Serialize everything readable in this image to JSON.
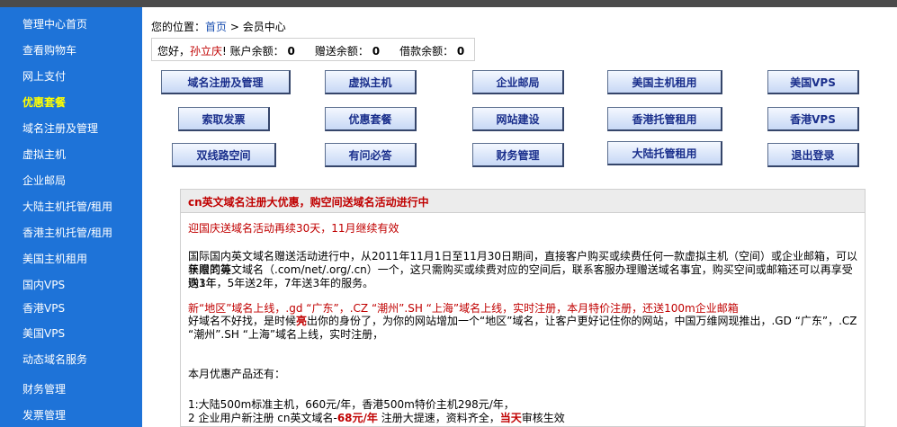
{
  "sidebar": {
    "items": [
      {
        "label": "管理中心首页"
      },
      {
        "label": "查看购物车"
      },
      {
        "label": "网上支付"
      },
      {
        "label": "优惠套餐"
      },
      {
        "label": "域名注册及管理"
      },
      {
        "label": "虚拟主机"
      },
      {
        "label": "企业邮局"
      },
      {
        "label": "大陆主机托管/租用"
      },
      {
        "label": "香港主机托管/租用"
      },
      {
        "label": "美国主机租用"
      },
      {
        "label": "国内VPS"
      },
      {
        "label": "香港VPS"
      },
      {
        "label": "美国VPS"
      },
      {
        "label": "动态域名服务"
      },
      {
        "label": "财务管理"
      },
      {
        "label": "发票管理"
      }
    ]
  },
  "breadcrumb": {
    "prefix": "您的位置：",
    "home": "首页",
    "sep": " > ",
    "current": "会员中心"
  },
  "balance": {
    "greeting": "您好，",
    "user": "孙立庆",
    "bang": "!",
    "account_label": " 账户余额：",
    "account_value": "0",
    "gift_label": "赠送余额：",
    "gift_value": "0",
    "loan_label": "借款余额：",
    "loan_value": "0"
  },
  "buttons": [
    "域名注册及管理",
    "虚拟主机",
    "企业邮局",
    "美国主机租用",
    "美国VPS",
    "索取发票",
    "优惠套餐",
    "网站建设",
    "香港托管租用",
    "香港VPS",
    "双线路空间",
    "有问必答",
    "财务管理",
    "大陆托管租用",
    "退出登录"
  ],
  "news": {
    "title": "cn英文域名注册大优惠，购空间送域名活动进行中",
    "p1": "迎国庆送域名活动再续30天，11月继续有效",
    "p2a": "国际国内英文域名赠送活动进行中，从2011年11月1日至11月30日期间，直接客户购买或续费任何一款虚拟主机（空间）或企业邮箱，可以获赠同等",
    "p2b": "年限的英文域名（.com/net/.org/.cn）一个，这只需购买或续费对应的空间后，联系客服办理赠送域名事宜，购买空间或邮箱还可以再享受购3年",
    "p2c": "送1年，5年送2年，7年送3年的服务。",
    "p3a": "新“地区”域名上线，.gd “广东”，.CZ “潮州”.SH “上海”域名上线，实时注册，本月特价注册，还送100m企业邮箱",
    "p3b_1": "好域名不好找，是时候",
    "p3b_hl": "亮",
    "p3b_2": "出你的身份了，为你的网站增加一个“地区”域名，让客户更好记住你的网站，中国万维网现推出，.GD “广东”，.CZ",
    "p3c": "“潮州”.SH “上海”域名上线，实时注册，",
    "p4": "本月优惠产品还有：",
    "p5": "1:大陆500m标准主机，660元/年，香港500m特价主机298元/年，",
    "p6_1": "2 企业用户新注册 cn英文域名-",
    "p6_hl": "68元/年",
    "p6_2": " 注册大提速，资料齐全，",
    "p6_hl2": "当天",
    "p6_3": "审核生效"
  }
}
